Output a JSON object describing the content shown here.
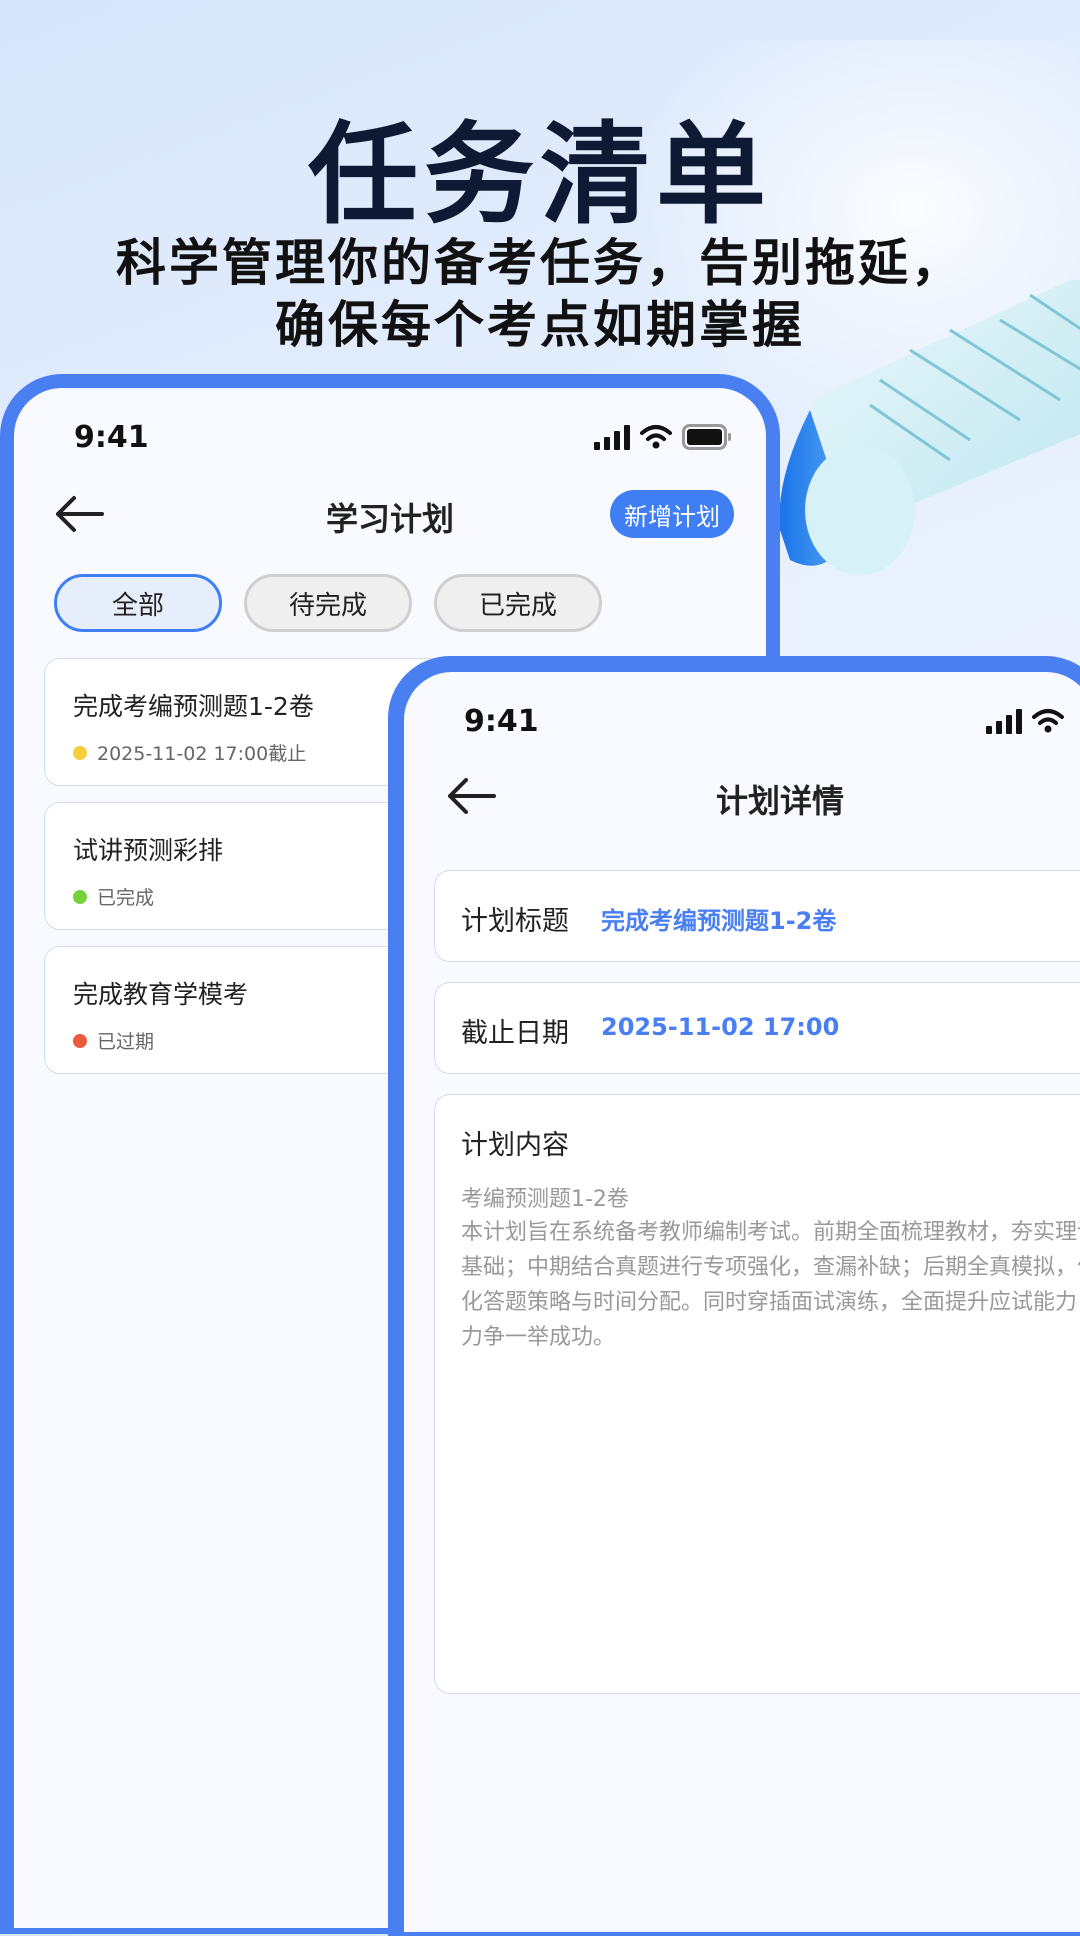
{
  "promo": {
    "title": "任务清单",
    "subtitle_line1": "科学管理你的备考任务，告别拖延，",
    "subtitle_line2": "确保每个考点如期掌握"
  },
  "phone1": {
    "time": "9:41",
    "nav_title": "学习计划",
    "new_button": "新增计划",
    "tabs": [
      {
        "label": "全部",
        "active": true
      },
      {
        "label": "待完成",
        "active": false
      },
      {
        "label": "已完成",
        "active": false
      }
    ],
    "tasks": [
      {
        "title": "完成考编预测题1-2卷",
        "meta": "2025-11-02  17:00截止",
        "status_color": "#f5cd3e"
      },
      {
        "title": "试讲预测彩排",
        "meta": "已完成",
        "status_color": "#76d23b"
      },
      {
        "title": "完成教育学模考",
        "meta": "已过期",
        "status_color": "#ee5a3c"
      }
    ]
  },
  "phone2": {
    "time": "9:41",
    "nav_title": "计划详情",
    "plan_title_label": "计划标题",
    "plan_title_value": "完成考编预测题1-2卷",
    "deadline_label": "截止日期",
    "deadline_value": "2025-11-02  17:00",
    "content_label": "计划内容",
    "content_subtitle": "考编预测题1-2卷",
    "content_body": "本计划旨在系统备考教师编制考试。前期全面梳理教材，夯实理论基础；中期结合真题进行专项强化，查漏补缺；后期全真模拟，优化答题策略与时间分配。同时穿插面试演练，全面提升应试能力，力争一举成功。"
  },
  "colors": {
    "accent": "#4a7ff2",
    "headline": "#0e1a33"
  }
}
